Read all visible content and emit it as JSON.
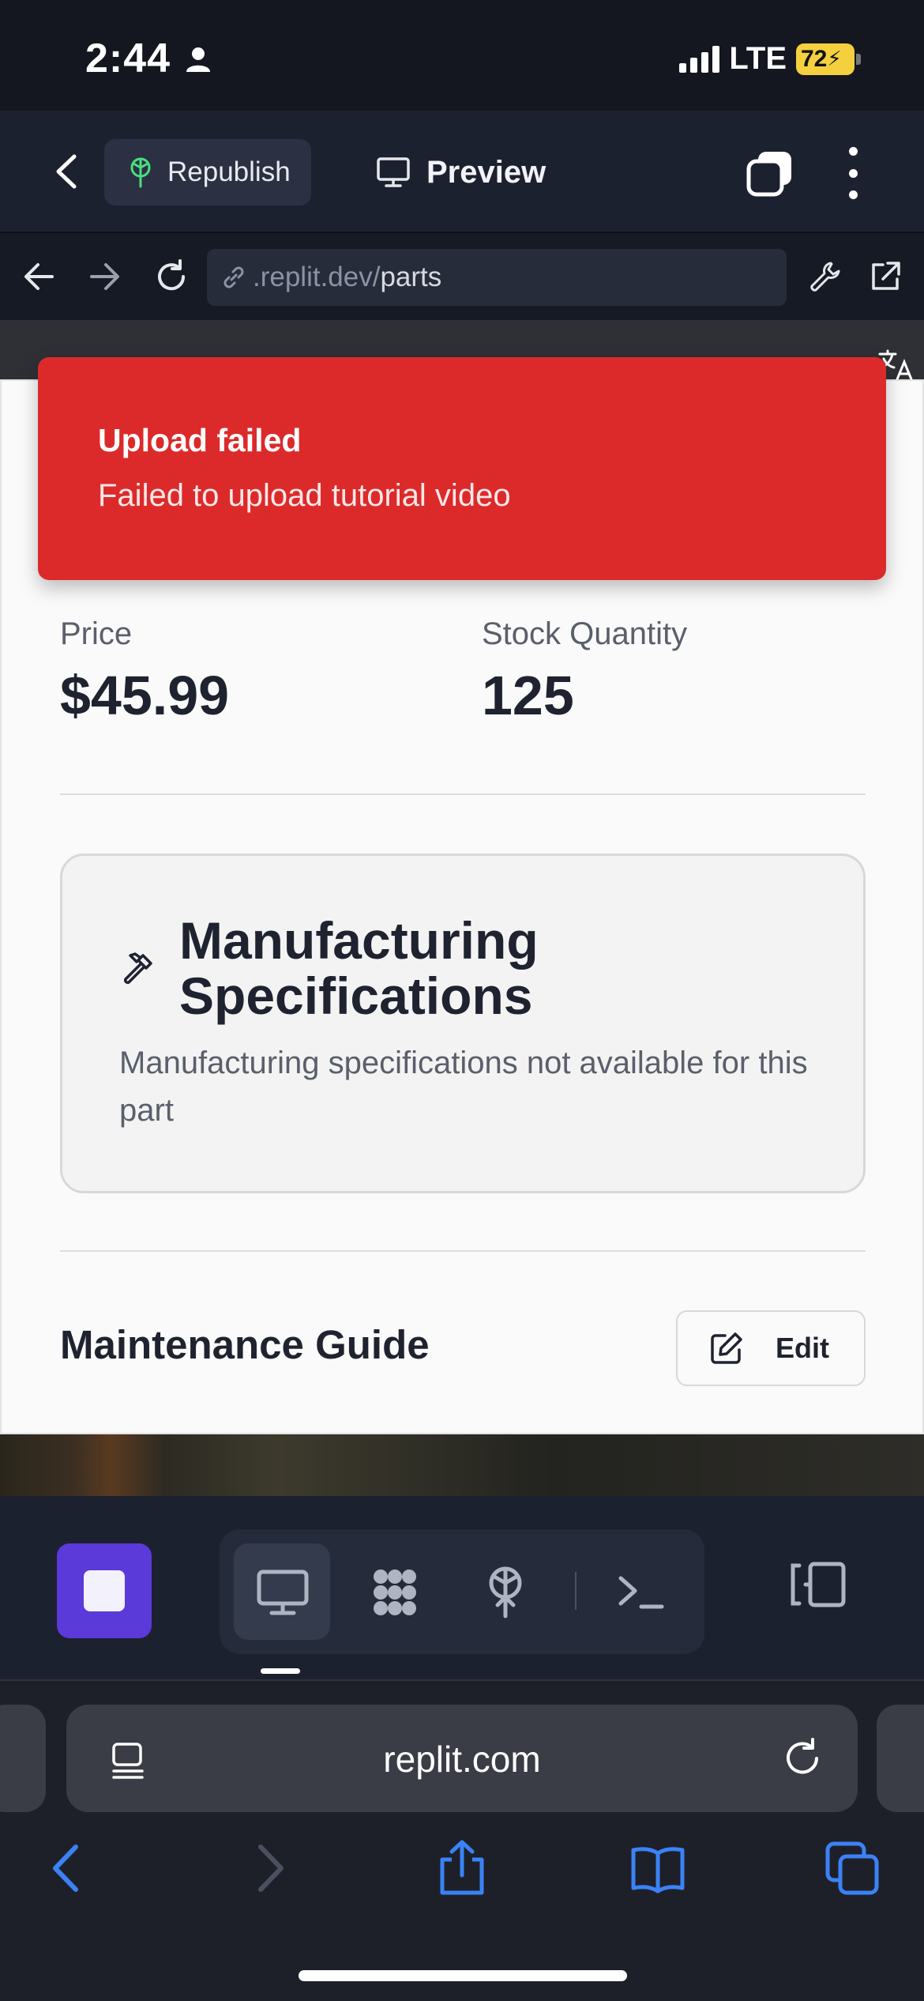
{
  "status_bar": {
    "time": "2:44",
    "network": "LTE",
    "battery": "72"
  },
  "replit_header": {
    "republish_label": "Republish",
    "preview_label": "Preview"
  },
  "url_bar": {
    "url_muted": ".replit.dev/",
    "url_path": "parts"
  },
  "toast": {
    "title": "Upload failed",
    "message": "Failed to upload tutorial video"
  },
  "part": {
    "price_label": "Price",
    "price_value": "$45.99",
    "stock_label": "Stock Quantity",
    "stock_value": "125"
  },
  "spec_card": {
    "title": "Manufacturing Specifications",
    "description": "Manufacturing specifications not available for this part"
  },
  "maintenance": {
    "title": "Maintenance Guide",
    "edit_label": "Edit"
  },
  "safari": {
    "address": "replit.com"
  },
  "colors": {
    "toast_red": "#dc2a2a",
    "stop_purple": "#5a3ad9",
    "safari_blue": "#3b82f6"
  }
}
